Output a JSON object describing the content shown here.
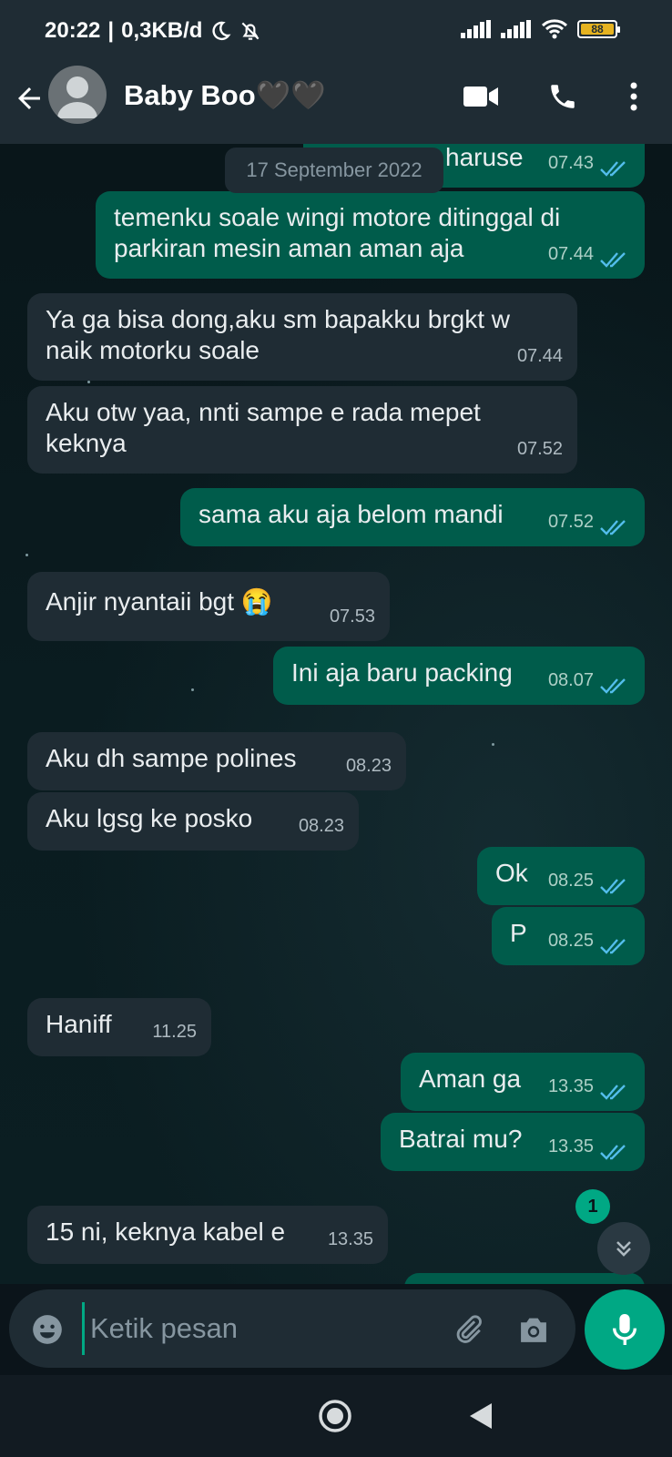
{
  "status_bar": {
    "time": "20:22",
    "separator": "|",
    "data_rate": "0,3KB/d",
    "battery": "88"
  },
  "header": {
    "contact_name": "Baby Boo🖤🖤"
  },
  "chat": {
    "date_chip": "17 September 2022",
    "messages": [
      {
        "dir": "out",
        "text": "haruse",
        "time": "07.43",
        "read": true
      },
      {
        "dir": "out",
        "text": "temenku soale wingi motore ditinggal di parkiran mesin aman aman aja",
        "time": "07.44",
        "read": true
      },
      {
        "dir": "in",
        "text": "Ya ga bisa dong,aku sm bapakku brgkt w naik motorku soale",
        "time": "07.44"
      },
      {
        "dir": "in",
        "text": "Aku otw yaa, nnti sampe e rada mepet keknya",
        "time": "07.52"
      },
      {
        "dir": "out",
        "text": "sama aku aja belom mandi",
        "time": "07.52",
        "read": true
      },
      {
        "dir": "in",
        "text": "Anjir nyantaii bgt 😭",
        "time": "07.53"
      },
      {
        "dir": "out",
        "text": "Ini aja baru packing",
        "time": "08.07",
        "read": true
      },
      {
        "dir": "in",
        "text": "Aku dh sampe polines",
        "time": "08.23"
      },
      {
        "dir": "in",
        "text": "Aku lgsg ke posko",
        "time": "08.23"
      },
      {
        "dir": "out",
        "text": "Ok",
        "time": "08.25",
        "read": true
      },
      {
        "dir": "out",
        "text": "P",
        "time": "08.25",
        "read": true
      },
      {
        "dir": "in",
        "text": "Haniff",
        "time": "11.25"
      },
      {
        "dir": "out",
        "text": "Aman ga",
        "time": "13.35",
        "read": true
      },
      {
        "dir": "out",
        "text": "Batrai mu?",
        "time": "13.35",
        "read": true
      },
      {
        "dir": "in",
        "text": "15 ni, keknya kabel e",
        "time": "13.35"
      }
    ],
    "unread_count": "1"
  },
  "composer": {
    "placeholder": "Ketik pesan"
  },
  "colors": {
    "incoming_bubble": "#1f2c34",
    "outgoing_bubble": "#005c4b",
    "accent": "#00a884",
    "read_ticks": "#53bdeb"
  }
}
